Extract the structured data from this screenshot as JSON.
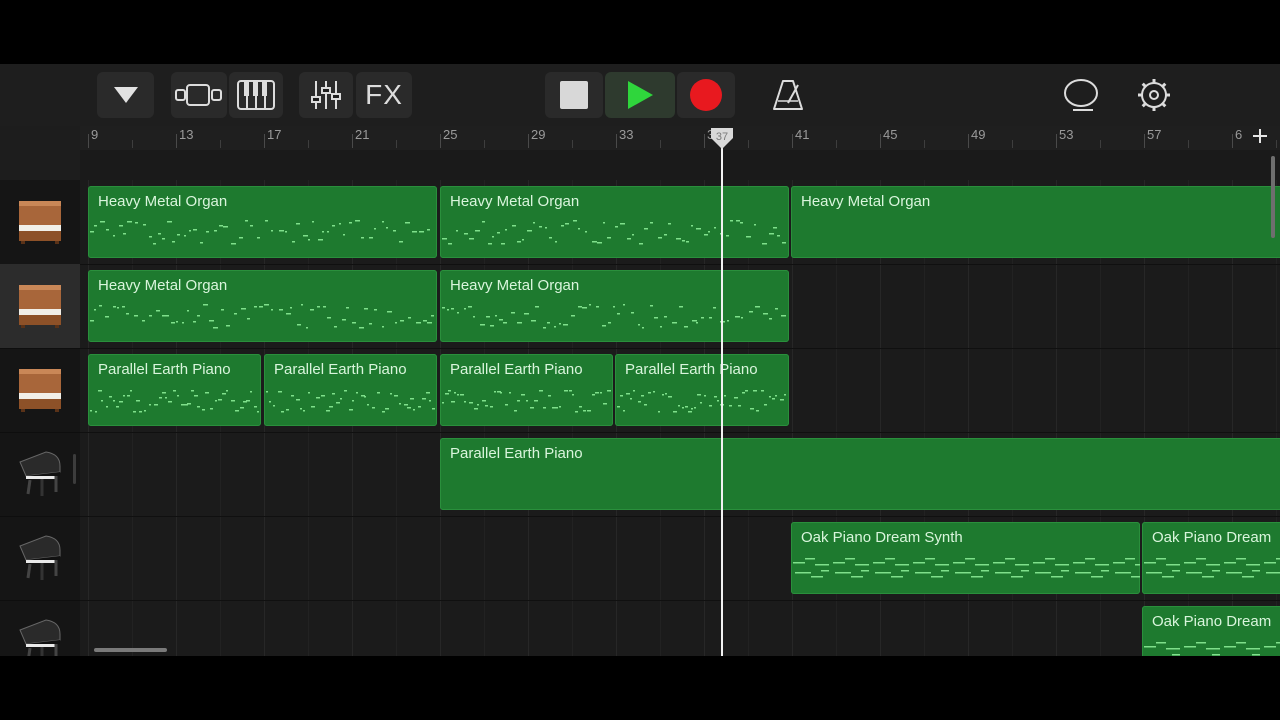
{
  "toolbar": {
    "fx_label": "FX",
    "buttons": [
      {
        "name": "browser-menu-button",
        "icon": "triangle-down-icon"
      },
      {
        "name": "view-toggle-button",
        "icon": "track-view-icon"
      },
      {
        "name": "keyboard-button",
        "icon": "piano-keys-icon"
      },
      {
        "name": "mixer-button",
        "icon": "mixer-sliders-icon"
      },
      {
        "name": "fx-button",
        "icon": "fx-icon"
      },
      {
        "name": "stop-button",
        "icon": "stop-icon"
      },
      {
        "name": "play-button",
        "icon": "play-icon"
      },
      {
        "name": "record-button",
        "icon": "record-icon"
      },
      {
        "name": "metronome-button",
        "icon": "metronome-icon"
      },
      {
        "name": "loop-browser-button",
        "icon": "loop-icon"
      },
      {
        "name": "settings-button",
        "icon": "gear-icon"
      }
    ],
    "colors": {
      "play": "#2fd63c",
      "record": "#e8191f"
    }
  },
  "ruler": {
    "bar_labels": [
      "9",
      "13",
      "17",
      "21",
      "25",
      "29",
      "33",
      "37",
      "41",
      "45",
      "49",
      "53",
      "57",
      "6"
    ],
    "playhead_bar": "37"
  },
  "tracks": [
    {
      "instrument_icon": "upright-piano-icon",
      "selected": false
    },
    {
      "instrument_icon": "upright-piano-icon",
      "selected": true
    },
    {
      "instrument_icon": "upright-piano-icon",
      "selected": false
    },
    {
      "instrument_icon": "grand-piano-icon",
      "selected": false
    },
    {
      "instrument_icon": "grand-piano-icon",
      "selected": false
    },
    {
      "instrument_icon": "grand-piano-icon",
      "selected": false
    }
  ],
  "regions": [
    {
      "track": 0,
      "label": "Heavy Metal Organ"
    },
    {
      "track": 0,
      "label": "Heavy Metal Organ"
    },
    {
      "track": 0,
      "label": "Heavy Metal Organ"
    },
    {
      "track": 1,
      "label": "Heavy Metal Organ"
    },
    {
      "track": 1,
      "label": "Heavy Metal Organ"
    },
    {
      "track": 2,
      "label": "Parallel Earth Piano"
    },
    {
      "track": 2,
      "label": "Parallel Earth Piano"
    },
    {
      "track": 2,
      "label": "Parallel Earth Piano"
    },
    {
      "track": 2,
      "label": "Parallel Earth Piano"
    },
    {
      "track": 3,
      "label": "Parallel Earth Piano"
    },
    {
      "track": 4,
      "label": "Oak Piano Dream Synth"
    },
    {
      "track": 4,
      "label": "Oak Piano Dream"
    },
    {
      "track": 5,
      "label": "Oak Piano Dream"
    }
  ],
  "colors": {
    "region_fill": "#1e7a2f",
    "region_text": "#d9f5dc",
    "note": "#7fe08b"
  }
}
